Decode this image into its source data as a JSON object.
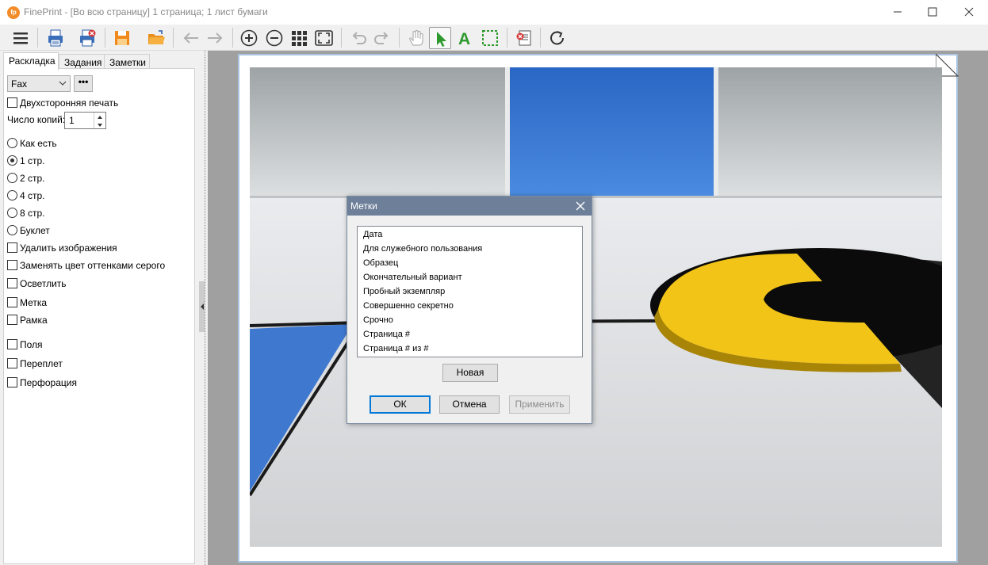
{
  "window": {
    "app_logo": "fp",
    "title": "FinePrint - [Во всю страницу] 1 страница; 1 лист бумаги"
  },
  "toolbar": {
    "icons": [
      "menu-icon",
      "print-icon",
      "print-delete-icon",
      "save-icon",
      "open-folder-icon",
      "back-icon",
      "forward-icon",
      "zoom-in-icon",
      "zoom-out-icon",
      "grid-icon",
      "fit-page-icon",
      "undo-icon",
      "redo-icon",
      "hand-icon",
      "pointer-icon",
      "text-icon",
      "select-icon",
      "delete-page-icon",
      "refresh-icon"
    ]
  },
  "left_panel": {
    "tabs": [
      "Раскладка",
      "Задания",
      "Заметки"
    ],
    "form_value": "Fax",
    "more_label": "•••",
    "duplex_label": "Двухсторонняя печать",
    "copies_label": "Число копий:",
    "copies_value": "1",
    "layouts": [
      "Как есть",
      "1 стр.",
      "2 стр.",
      "4 стр.",
      "8 стр.",
      "Буклет"
    ],
    "selected_layout": "1 стр.",
    "options": [
      "Удалить изображения",
      "Заменять цвет оттенками серого",
      "Осветлить",
      "Метка",
      "Рамка"
    ],
    "options2": [
      "Поля",
      "Переплет",
      "Перфорация"
    ]
  },
  "dialog": {
    "title": "Метки",
    "items": [
      "Дата",
      "Для служебного пользования",
      "Образец",
      "Окончательный вариант",
      "Пробный экземпляр",
      "Совершенно секретно",
      "Срочно",
      "Страница #",
      "Страница # из #"
    ],
    "new_button": "Новая",
    "ok_button": "ОК",
    "cancel_button": "Отмена",
    "apply_button": "Применить"
  },
  "colors": {
    "accent": "#0078d7",
    "dialog_title": "#6e8099",
    "photo_blue": "#2f6fd0",
    "photo_yellow": "#f2c417"
  }
}
